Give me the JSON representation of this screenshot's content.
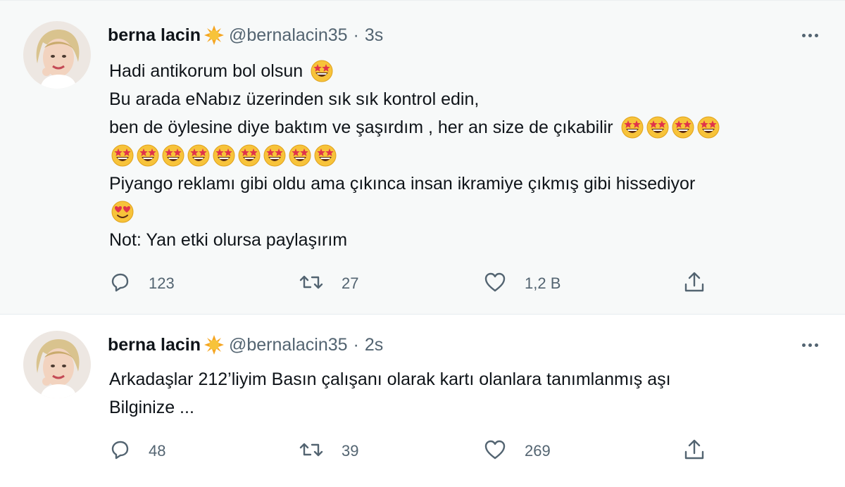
{
  "tweets": [
    {
      "author": {
        "name": "berna lacin",
        "handle": "@bernalacin35"
      },
      "time": "3s",
      "lines": [
        {
          "text": "Hadi antikorum bol olsun",
          "emoji": [
            "star-struck"
          ]
        },
        {
          "text": "Bu arada eNabız üzerinden sık sık kontrol edin,",
          "emoji": []
        },
        {
          "text": "ben de öylesine diye baktım ve şaşırdım , her an size de çıkabilir",
          "emoji": [
            "star-struck",
            "star-struck",
            "star-struck",
            "star-struck"
          ]
        },
        {
          "text": "",
          "emoji": [
            "star-struck",
            "star-struck",
            "star-struck",
            "star-struck",
            "star-struck",
            "star-struck",
            "star-struck",
            "star-struck",
            "star-struck"
          ]
        },
        {
          "text": "Piyango reklamı gibi oldu ama çıkınca insan ikramiye çıkmış gibi hissediyor",
          "emoji": []
        },
        {
          "text": "",
          "emoji": [
            "heart-eyes"
          ]
        },
        {
          "text": "Not: Yan etki olursa paylaşırım",
          "emoji": []
        }
      ],
      "actions": {
        "replies": "123",
        "retweets": "27",
        "likes": "1,2 B"
      }
    },
    {
      "author": {
        "name": "berna lacin",
        "handle": "@bernalacin35"
      },
      "time": "2s",
      "lines": [
        {
          "text": "Arkadaşlar 212’liyim Basın çalışanı olarak kartı olanlara tanımlanmış aşı",
          "emoji": []
        },
        {
          "text": "Bilginize ...",
          "emoji": []
        }
      ],
      "actions": {
        "replies": "48",
        "retweets": "39",
        "likes": "269"
      }
    }
  ],
  "icons": {
    "verified_sun": "sun-emoji-icon",
    "reply": "reply-icon",
    "retweet": "retweet-icon",
    "like": "heart-icon",
    "share": "share-icon",
    "more": "more-icon"
  },
  "colors": {
    "icon_gray": "#536471",
    "thread_line": "#c4cfd6",
    "first_bg": "#f7f9f9",
    "emoji_yellow": "#f7c33a",
    "emoji_red": "#e0334a"
  }
}
